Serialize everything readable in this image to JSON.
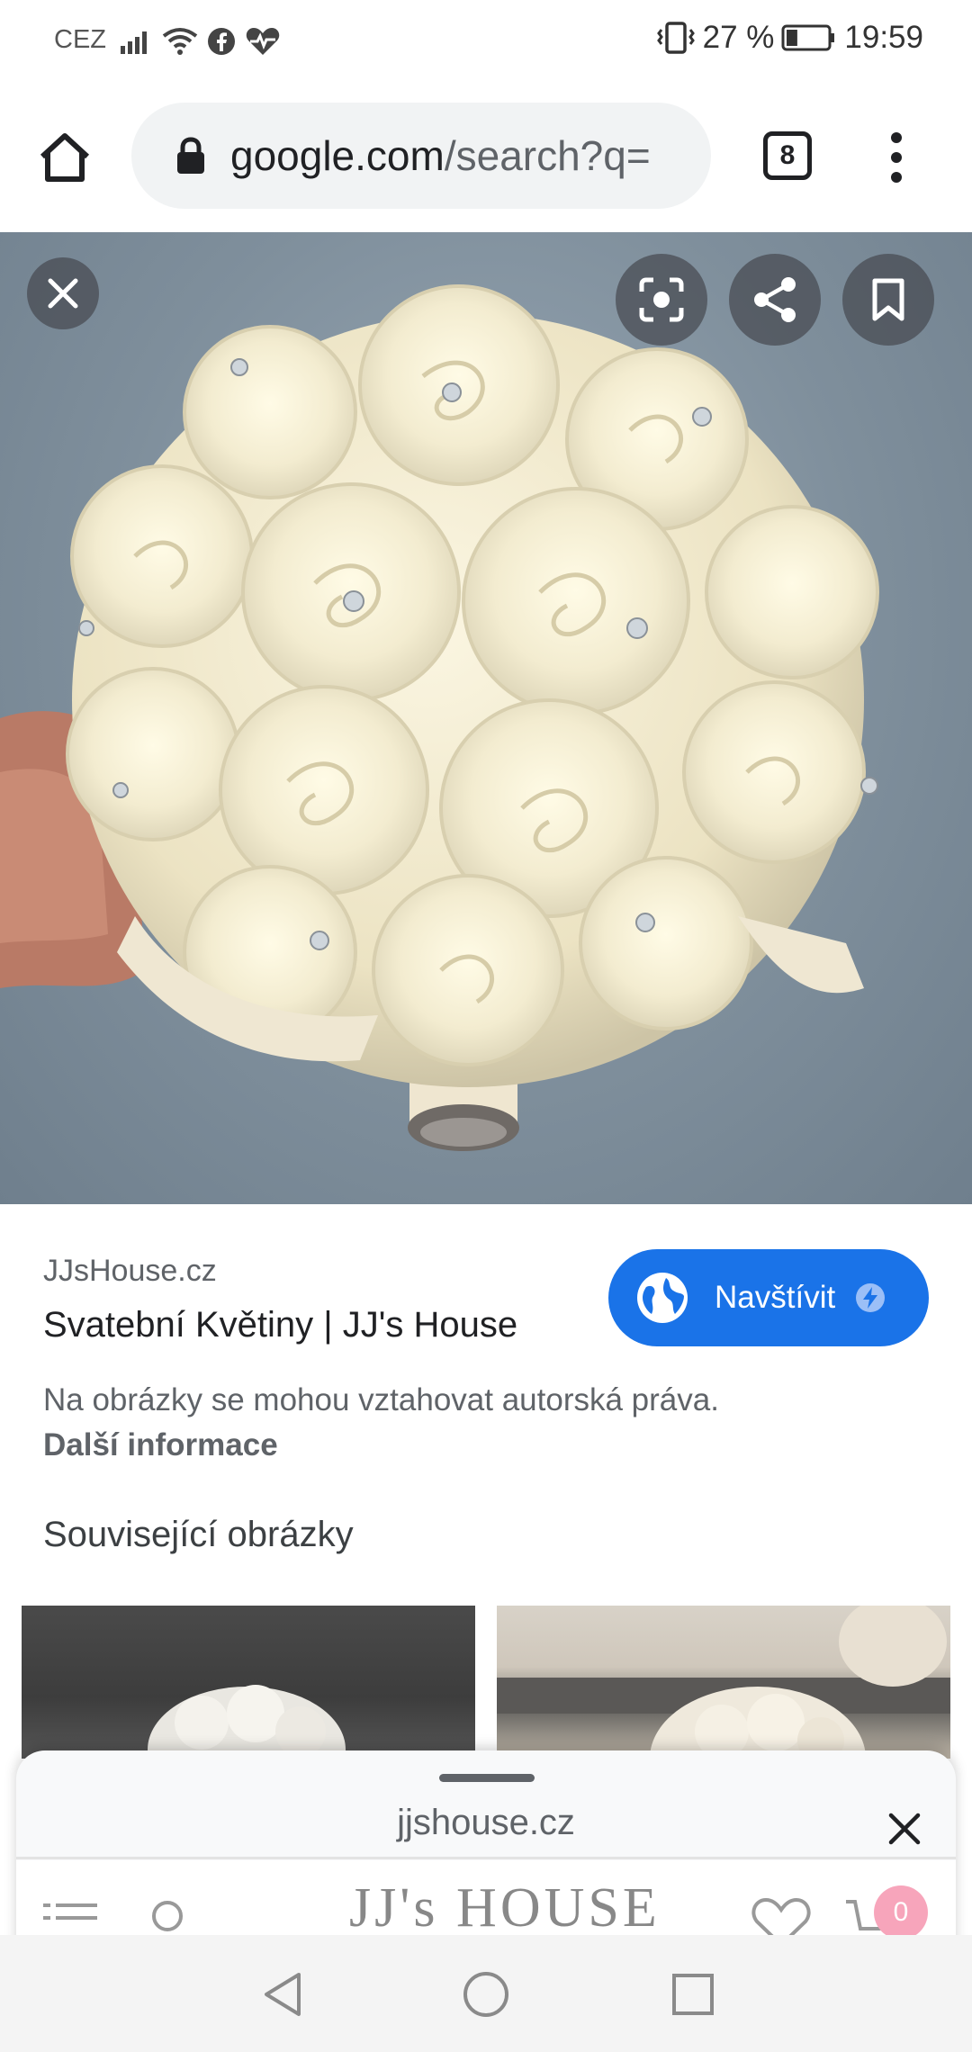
{
  "status_bar": {
    "carrier": "CEZ",
    "battery_percent": "27 %",
    "battery_level": 0.27,
    "time": "19:59"
  },
  "browser": {
    "url_domain": "google.com",
    "url_path": "/search?q=",
    "tab_count": "8"
  },
  "image_viewer": {
    "subject": "white rose bridal bouquet",
    "buttons": [
      "close-icon",
      "lens-icon",
      "share-icon",
      "bookmark-icon"
    ]
  },
  "result": {
    "source": "JJsHouse.cz",
    "title": "Svatební Květiny | JJ's House",
    "visit_label": "Navštívit",
    "copyright_notice": "Na obrázky se mohou vztahovat autorská práva.",
    "more_info_link": "Další informace",
    "related_heading": "Související obrázky"
  },
  "bottom_sheet": {
    "title": "jjshouse.cz",
    "site_logo": "JJ's HOUSE",
    "cart_count": "0"
  },
  "colors": {
    "accent": "#1a73e8",
    "omnibox_bg": "#f1f3f4",
    "cart_badge": "#f7a5bb"
  }
}
